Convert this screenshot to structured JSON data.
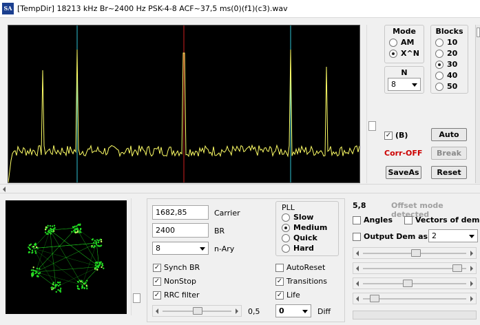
{
  "window": {
    "icon_text": "SA",
    "title": "[TempDir] 18213 kHz Br~2400 Hz PSK-4-8 ACF~37,5 ms(0)(f1)(c3).wav"
  },
  "mode": {
    "title": "Mode",
    "options": [
      {
        "label": "AM",
        "selected": false
      },
      {
        "label": "X^N",
        "selected": true
      }
    ]
  },
  "blocks": {
    "title": "Blocks",
    "options": [
      {
        "label": "10",
        "selected": false
      },
      {
        "label": "20",
        "selected": false
      },
      {
        "label": "30",
        "selected": true
      },
      {
        "label": "40",
        "selected": false
      },
      {
        "label": "50",
        "selected": false
      }
    ]
  },
  "n_select": {
    "title": "N",
    "value": "8"
  },
  "b_check": {
    "label": "(B)",
    "checked": true
  },
  "corr_status": {
    "text": "Corr-OFF",
    "color": "#cc0000"
  },
  "buttons": {
    "auto": "Auto",
    "break": "Break",
    "saveas": "SaveAs",
    "reset": "Reset"
  },
  "params": {
    "carrier_value": "1682,85",
    "carrier_label": "Carrier",
    "br_value": "2400",
    "br_label": "BR",
    "nary_value": "8",
    "nary_label": "n-Ary"
  },
  "pll": {
    "title": "PLL",
    "options": [
      {
        "label": "Slow",
        "selected": false
      },
      {
        "label": "Medium",
        "selected": true
      },
      {
        "label": "Quick",
        "selected": false
      },
      {
        "label": "Hard",
        "selected": false
      }
    ]
  },
  "checks": {
    "synch_br": {
      "label": "Synch BR",
      "checked": true
    },
    "nonstop": {
      "label": "NonStop",
      "checked": true
    },
    "rrc": {
      "label": "RRC filter",
      "checked": true
    },
    "autoreset": {
      "label": "AutoReset",
      "checked": false
    },
    "transitions": {
      "label": "Transitions",
      "checked": true
    },
    "life": {
      "label": "Life",
      "checked": true
    }
  },
  "rrc_value": "0,5",
  "diff": {
    "value": "0",
    "label": "Diff"
  },
  "offset": {
    "value": "5,8",
    "status": "Offset mode detected"
  },
  "angles": {
    "label": "Angles",
    "checked": false
  },
  "vectors": {
    "label": "Vectors of dem",
    "checked": false
  },
  "output_dem": {
    "label": "Output Dem as",
    "checked": false,
    "value": "2"
  },
  "colors": {
    "spectrum_trace": "#ffff66",
    "marker_cyan": "#2fc4d6",
    "marker_red": "#d02020",
    "constellation": "#22dd22"
  }
}
